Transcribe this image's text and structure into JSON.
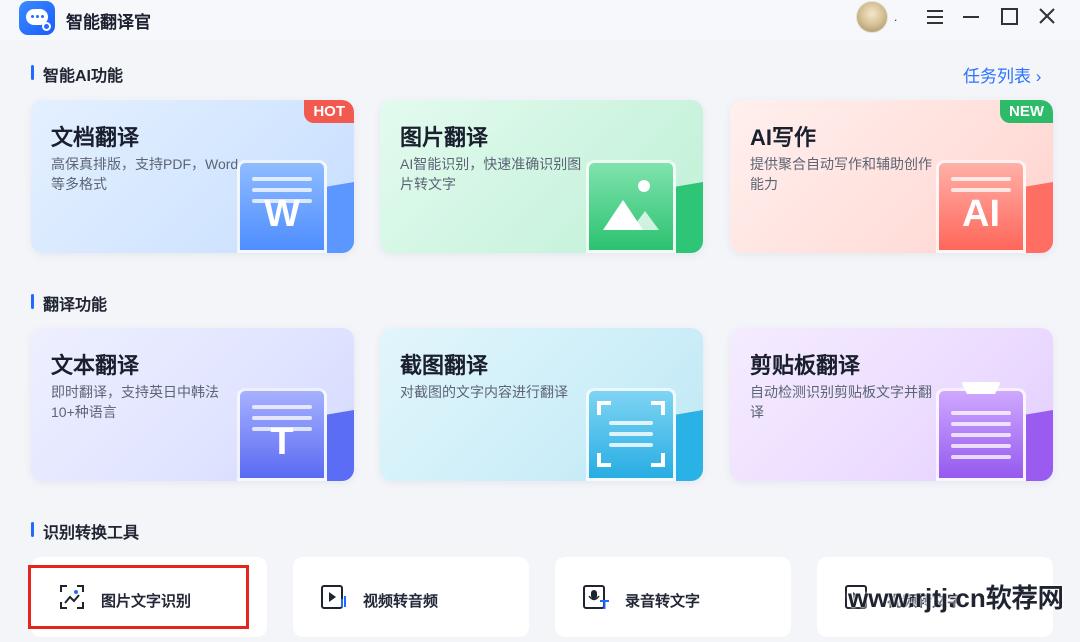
{
  "app": {
    "title": "智能翻译官",
    "user_name": "."
  },
  "sections": {
    "ai": {
      "title": "智能AI功能",
      "task_link": "任务列表 ›"
    },
    "translate": {
      "title": "翻译功能"
    },
    "tools": {
      "title": "识别转换工具"
    }
  },
  "ai_cards": [
    {
      "title": "文档翻译",
      "desc": "高保真排版，支持PDF，Word等多格式",
      "badge": "HOT",
      "glyph": "W"
    },
    {
      "title": "图片翻译",
      "desc": "AI智能识别，快速准确识别图片转文字",
      "badge": "",
      "glyph": ""
    },
    {
      "title": "AI写作",
      "desc": "提供聚合自动写作和辅助创作能力",
      "badge": "NEW",
      "glyph": "AI"
    }
  ],
  "translate_cards": [
    {
      "title": "文本翻译",
      "desc": "即时翻译，支持英日中韩法10+种语言",
      "glyph": "T"
    },
    {
      "title": "截图翻译",
      "desc": "对截图的文字内容进行翻译"
    },
    {
      "title": "剪贴板翻译",
      "desc": "自动检测识别剪贴板文字并翻译"
    }
  ],
  "tools": [
    {
      "label": "图片文字识别",
      "icon": "image-scan-icon"
    },
    {
      "label": "视频转音频",
      "icon": "video-audio-icon"
    },
    {
      "label": "录音转文字",
      "icon": "recording-text-icon"
    },
    {
      "label": "视频转文字",
      "icon": "video-text-icon"
    }
  ],
  "watermark": "www.rjtj.cn软荐网",
  "colors": {
    "accent": "#1f6bff",
    "hot": "#f25a4f",
    "new": "#2dbb6a",
    "highlight": "#e5251c"
  }
}
